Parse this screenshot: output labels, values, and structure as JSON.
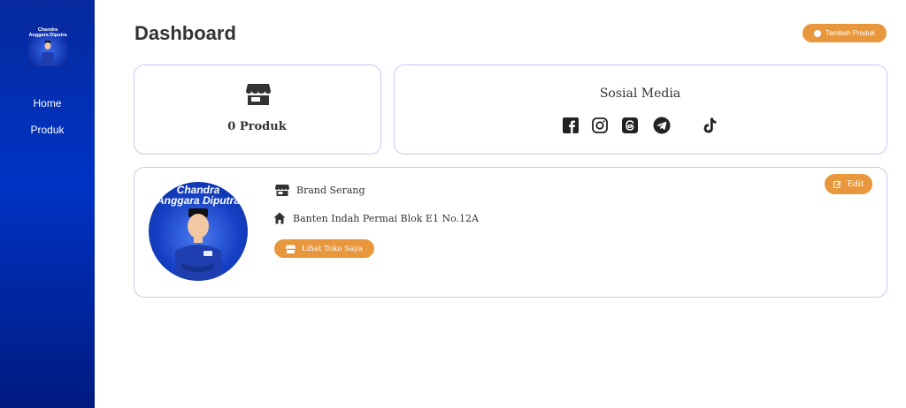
{
  "sidebar": {
    "logo_text_line1": "Chandra",
    "logo_text_line2": "Anggara Diputra",
    "items": [
      {
        "label": "Home"
      },
      {
        "label": "Produk"
      }
    ]
  },
  "header": {
    "title": "Dashboard",
    "add_button_label": "Tambah Produk"
  },
  "produk_card": {
    "icon": "store-icon",
    "count_label": "0 Produk"
  },
  "sosial_card": {
    "title": "Sosial Media",
    "icons": [
      "facebook-icon",
      "instagram-icon",
      "threads-icon",
      "telegram-icon",
      "tiktok-icon"
    ]
  },
  "profile_card": {
    "avatar_name_line1": "Chandra",
    "avatar_name_line2": "Anggara Diputra",
    "brand_name": "Brand Serang",
    "address": "Banten Indah Permai Blok E1 No.12A",
    "lihat_button_label": "Lihat Toko Saya",
    "edit_button_label": "Edit"
  },
  "colors": {
    "sidebar_bg": "#0033c4",
    "accent_orange": "#e8973c",
    "card_border": "#c4cdef",
    "text_dark": "#333333"
  }
}
